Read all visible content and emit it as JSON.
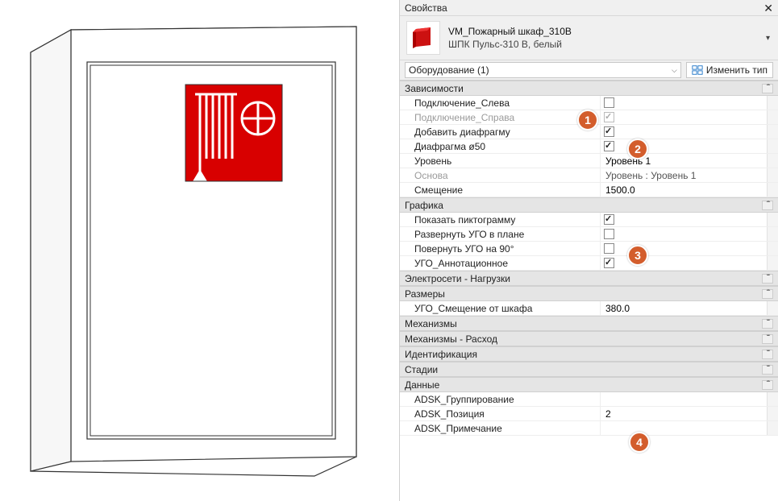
{
  "panel": {
    "title": "Свойства",
    "type_name": "VM_Пожарный шкаф_310B",
    "type_sub": "ШПК Пульс-310 В, белый",
    "selector_text": "Оборудование (1)",
    "edit_type_label": "Изменить тип",
    "thumb_color": "#cc1111"
  },
  "callouts": [
    "1",
    "2",
    "3",
    "4"
  ],
  "groups": [
    {
      "name": "Зависимости",
      "rows": [
        {
          "label": "Подключение_Слева",
          "type": "checkbox",
          "checked": false,
          "active": true
        },
        {
          "label": "Подключение_Справа",
          "type": "checkbox",
          "checked": true,
          "disabled": true
        },
        {
          "label": "Добавить диафрагму",
          "type": "checkbox",
          "checked": true
        },
        {
          "label": "Диафрагма ø50",
          "type": "checkbox",
          "checked": true
        },
        {
          "label": "Уровень",
          "type": "text",
          "value": "Уровень 1"
        },
        {
          "label": "Основа",
          "type": "text",
          "value": "Уровень : Уровень 1",
          "disabled": true
        },
        {
          "label": "Смещение",
          "type": "text",
          "value": "1500.0"
        }
      ]
    },
    {
      "name": "Графика",
      "rows": [
        {
          "label": "Показать пиктограмму",
          "type": "checkbox",
          "checked": true
        },
        {
          "label": "Развернуть УГО в плане",
          "type": "checkbox",
          "checked": false
        },
        {
          "label": "Повернуть УГО на 90°",
          "type": "checkbox",
          "checked": false
        },
        {
          "label": "УГО_Аннотационное",
          "type": "checkbox",
          "checked": true
        }
      ]
    },
    {
      "name": "Электросети - Нагрузки",
      "collapsed": true,
      "rows": []
    },
    {
      "name": "Размеры",
      "rows": [
        {
          "label": "УГО_Смещение от шкафа",
          "type": "text",
          "value": "380.0"
        }
      ]
    },
    {
      "name": "Механизмы",
      "collapsed": true,
      "rows": []
    },
    {
      "name": "Механизмы - Расход",
      "collapsed": true,
      "rows": []
    },
    {
      "name": "Идентификация",
      "collapsed": true,
      "rows": []
    },
    {
      "name": "Стадии",
      "collapsed": true,
      "rows": []
    },
    {
      "name": "Данные",
      "rows": [
        {
          "label": "ADSK_Группирование",
          "type": "text",
          "value": ""
        },
        {
          "label": "ADSK_Позиция",
          "type": "text",
          "value": "2"
        },
        {
          "label": "ADSK_Примечание",
          "type": "text",
          "value": ""
        }
      ]
    }
  ]
}
